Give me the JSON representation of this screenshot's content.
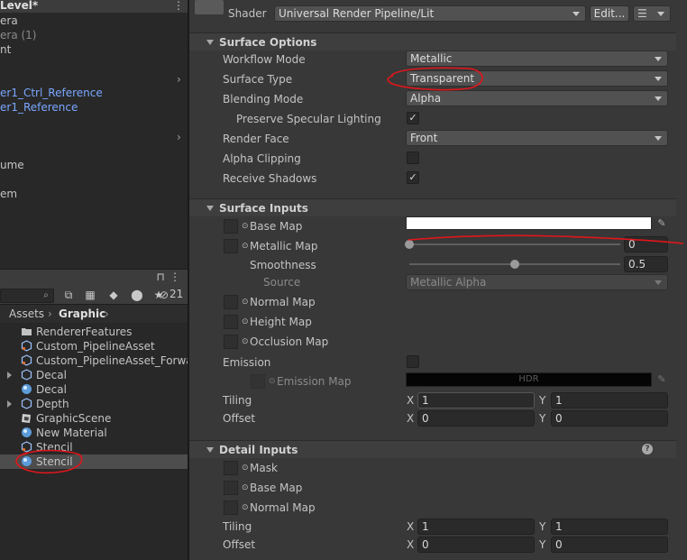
{
  "hierarchy": {
    "title": "Level*",
    "items": [
      "era",
      "era (1)",
      "nt",
      "er1_Ctrl_Reference",
      "er1_Reference",
      "ume",
      "em"
    ]
  },
  "project": {
    "hidden_count": "21",
    "breadcrumb": [
      "Assets",
      "Graphic"
    ],
    "assets": [
      {
        "name": "RendererFeatures",
        "icon": "folder-icon",
        "expandable": false
      },
      {
        "name": "Custom_PipelineAsset",
        "icon": "pipeline-asset-icon",
        "expandable": false
      },
      {
        "name": "Custom_PipelineAsset_Forwar",
        "icon": "pipeline-asset-icon",
        "expandable": false
      },
      {
        "name": "Decal",
        "icon": "prefab-icon",
        "expandable": true
      },
      {
        "name": "Decal",
        "icon": "material-icon",
        "expandable": false
      },
      {
        "name": "Depth",
        "icon": "prefab-icon",
        "expandable": true
      },
      {
        "name": "GraphicScene",
        "icon": "scene-icon",
        "expandable": false
      },
      {
        "name": "New Material",
        "icon": "material-icon",
        "expandable": false
      },
      {
        "name": "Stencil",
        "icon": "pipeline-asset-icon",
        "expandable": false
      },
      {
        "name": "Stencil",
        "icon": "material-icon",
        "expandable": false,
        "selected": true
      }
    ]
  },
  "inspector": {
    "shader_label": "Shader",
    "shader_value": "Universal Render Pipeline/Lit",
    "edit_button": "Edit...",
    "surface_options": {
      "title": "Surface Options",
      "workflow_mode_label": "Workflow Mode",
      "workflow_mode_value": "Metallic",
      "surface_type_label": "Surface Type",
      "surface_type_value": "Transparent",
      "blending_mode_label": "Blending Mode",
      "blending_mode_value": "Alpha",
      "preserve_specular_label": "Preserve Specular Lighting",
      "preserve_specular_checked": true,
      "render_face_label": "Render Face",
      "render_face_value": "Front",
      "alpha_clipping_label": "Alpha Clipping",
      "alpha_clipping_checked": false,
      "receive_shadows_label": "Receive Shadows",
      "receive_shadows_checked": true
    },
    "surface_inputs": {
      "title": "Surface Inputs",
      "base_map_label": "Base Map",
      "base_map_color": "#ffffff",
      "metallic_map_label": "Metallic Map",
      "metallic_value": "0",
      "metallic_fraction": 0,
      "smoothness_label": "Smoothness",
      "smoothness_value": "0.5",
      "smoothness_fraction": 0.5,
      "source_label": "Source",
      "source_value": "Metallic Alpha",
      "normal_map_label": "Normal Map",
      "height_map_label": "Height Map",
      "occlusion_map_label": "Occlusion Map",
      "emission_label": "Emission",
      "emission_map_label": "Emission Map",
      "emission_hdr": "HDR",
      "tiling_label": "Tiling",
      "tiling_x": "1",
      "tiling_y": "1",
      "offset_label": "Offset",
      "offset_x": "0",
      "offset_y": "0"
    },
    "detail_inputs": {
      "title": "Detail Inputs",
      "mask_label": "Mask",
      "base_map_label": "Base Map",
      "normal_map_label": "Normal Map",
      "tiling_label": "Tiling",
      "tiling_x": "1",
      "tiling_y": "1",
      "offset_label": "Offset",
      "offset_x": "0",
      "offset_y": "0"
    },
    "axis_x": "X",
    "axis_y": "Y"
  },
  "colors": {
    "annotation": "#e0161b",
    "link_blue": "#7aa7ff"
  }
}
